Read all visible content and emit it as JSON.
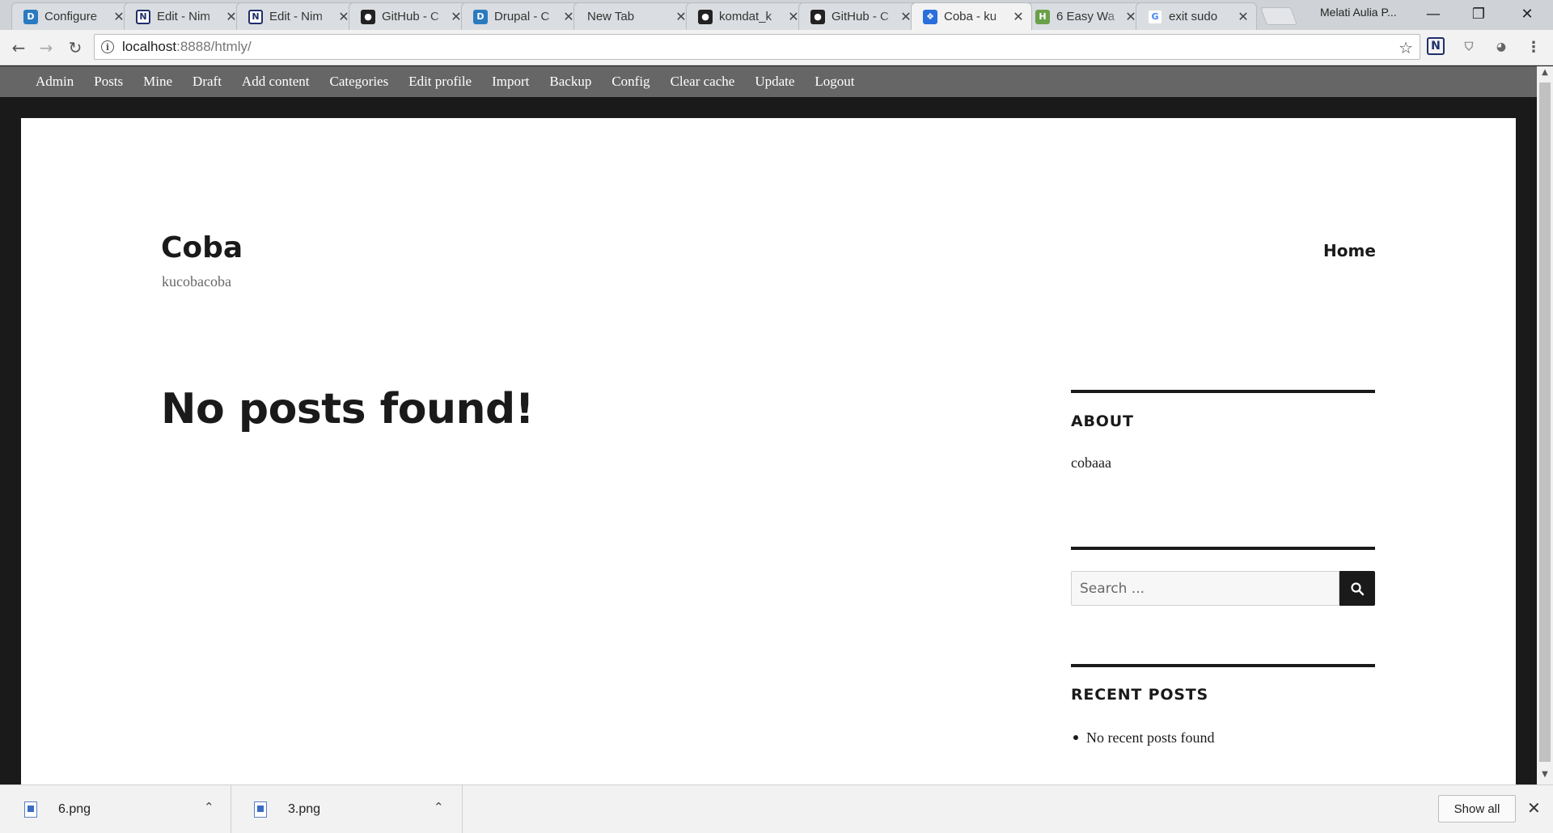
{
  "browser": {
    "tabs": [
      {
        "title": "Configure",
        "icon": "drupal-icon"
      },
      {
        "title": "Edit - Nim",
        "icon": "notion-icon"
      },
      {
        "title": "Edit - Nim",
        "icon": "notion-icon"
      },
      {
        "title": "GitHub - C",
        "icon": "github-icon"
      },
      {
        "title": "Drupal - C",
        "icon": "drupal-icon"
      },
      {
        "title": "New Tab",
        "icon": ""
      },
      {
        "title": "komdat_k",
        "icon": "github-icon"
      },
      {
        "title": "GitHub - C",
        "icon": "github-icon"
      },
      {
        "title": "Coba - ku",
        "icon": "coba-icon",
        "active": true
      },
      {
        "title": "6 Easy Wa",
        "icon": "wikihow-icon"
      },
      {
        "title": "exit sudo",
        "icon": "google-icon"
      }
    ],
    "profile_name": "Melati Aulia P...",
    "url_host": "localhost",
    "url_rest": ":8888/htmly/"
  },
  "adminbar": {
    "items": [
      "Admin",
      "Posts",
      "Mine",
      "Draft",
      "Add content",
      "Categories",
      "Edit profile",
      "Import",
      "Backup",
      "Config",
      "Clear cache",
      "Update",
      "Logout"
    ]
  },
  "site": {
    "title": "Coba",
    "description": "kucobacoba",
    "nav_home": "Home"
  },
  "main": {
    "message": "No posts found!"
  },
  "sidebar": {
    "about_title": "ABOUT",
    "about_text": "cobaaa",
    "search_placeholder": "Search ...",
    "recent_title": "RECENT POSTS",
    "recent_empty": "No recent posts found"
  },
  "downloads": {
    "items": [
      "6.png",
      "3.png"
    ],
    "show_all": "Show all"
  }
}
